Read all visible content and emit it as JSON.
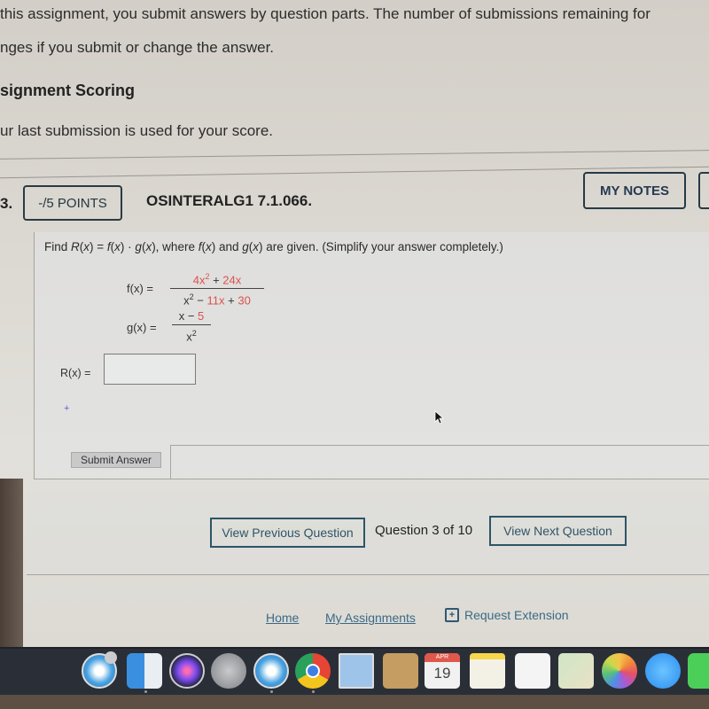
{
  "instructions": {
    "line1": "this assignment, you submit answers by question parts. The number of submissions remaining for",
    "line2": "nges if you submit or change the answer.",
    "scoring_title": "signment Scoring",
    "scoring_text": "ur last submission is used for your score."
  },
  "question": {
    "number": "3.",
    "points_label": "-/5 POINTS",
    "code": "OSINTERALG1 7.1.066.",
    "my_notes_label": "MY NOTES",
    "prompt_parts": [
      "Find ",
      "R",
      "(",
      "x",
      ") = ",
      "f",
      "(",
      "x",
      ") · ",
      "g",
      "(",
      "x",
      "), where ",
      "f",
      "(",
      "x",
      ") and ",
      "g",
      "(",
      "x",
      ") are given. (Simplify your answer completely.)"
    ],
    "f": {
      "label": "f(x)  =",
      "numerator": {
        "a": "4x",
        "a_exp": "2",
        "op": " + ",
        "b": "24x"
      },
      "denominator": {
        "a": "x",
        "a_exp": "2",
        "op1": " − ",
        "b": "11x",
        "op2": " + ",
        "c": "30"
      }
    },
    "g": {
      "label": "g(x)  =",
      "numerator": {
        "a": "x − ",
        "b": "5"
      },
      "denominator": {
        "a": "x",
        "a_exp": "2"
      }
    },
    "answer_label": "R(x)  =",
    "answer_value": "",
    "plus_mark": "+",
    "submit_label": "Submit Answer"
  },
  "navigation": {
    "prev_label": "View Previous Question",
    "counter": "Question 3 of 10",
    "next_label": "View Next Question"
  },
  "footer": {
    "home": "Home",
    "assignments": "My Assignments",
    "extension": "Request Extension",
    "extension_icon": "calendar-plus-icon"
  },
  "dock": {
    "calendar_month": "APR",
    "calendar_day": "19",
    "apps": [
      "safari-icon",
      "finder-icon",
      "siri-icon",
      "launchpad-icon",
      "safari-icon",
      "chrome-icon",
      "mail-icon",
      "contacts-icon",
      "calendar-icon",
      "notes-icon",
      "reminders-icon",
      "maps-icon",
      "photos-icon",
      "messages-icon",
      "facetime-icon"
    ]
  },
  "colors": {
    "accent_red": "#d9534f",
    "link_blue": "#3a6a86",
    "button_border": "#2d5566"
  }
}
